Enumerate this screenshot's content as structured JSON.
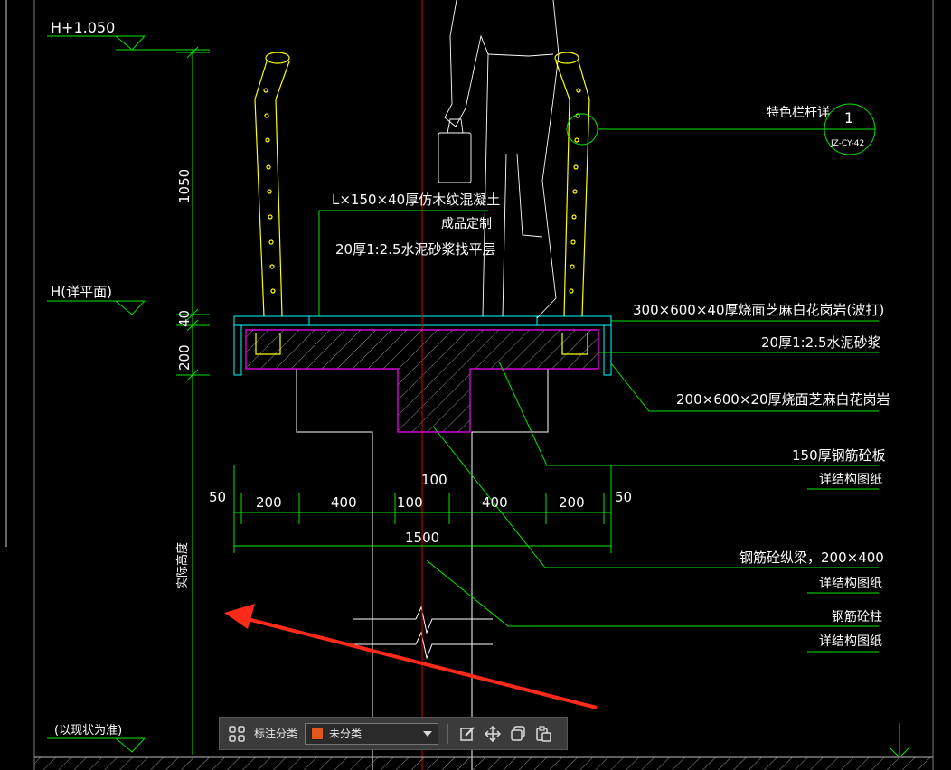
{
  "drawing": {
    "levels": {
      "top": "H+1.050",
      "middle": "H(详平面)",
      "bottom": "(以现状为准)"
    },
    "dimensions": {
      "vertical_1050": "1050",
      "vertical_200": "200",
      "vertical_40": "40",
      "vertical_side": "实际高度",
      "horizontal": [
        "50",
        "200",
        "400",
        "100",
        "400",
        "200",
        "50"
      ],
      "horizontal_100_top": "100",
      "total": "1500"
    },
    "callout": {
      "title": "特色栏杆详",
      "number": "1",
      "ref": "JZ-CY-42"
    },
    "notes": {
      "wood_line1": "L×150×40厚仿木纹混凝土",
      "wood_line2": "成品定制",
      "wood_line3": "20厚1:2.5水泥砂浆找平层",
      "granite_top": "300×600×40厚烧面芝麻白花岗岩(波打)",
      "mortar": "20厚1:2.5水泥砂浆",
      "granite_side": "200×600×20厚烧面芝麻白花岗岩",
      "slab_line1": "150厚钢筋砼板",
      "slab_line2": "详结构图纸",
      "beam_line1": "钢筋砼纵梁，200×400",
      "beam_line2": "详结构图纸",
      "column_line1": "钢筋砼柱",
      "column_line2": "详结构图纸"
    }
  },
  "toolbar": {
    "label": "标注分类",
    "category": "未分类",
    "icons": [
      "grid-icon",
      "edit-icon",
      "move-icon",
      "copy-icon",
      "paste-icon"
    ]
  },
  "colors": {
    "annotation": "#00e600",
    "text": "#ffffff",
    "railing": "#ffff00",
    "slab": "#ff00ff",
    "paving": "#00ffff",
    "centerline": "#e00000",
    "arrow": "#ff2a1a",
    "category_swatch": "#e4571c"
  }
}
